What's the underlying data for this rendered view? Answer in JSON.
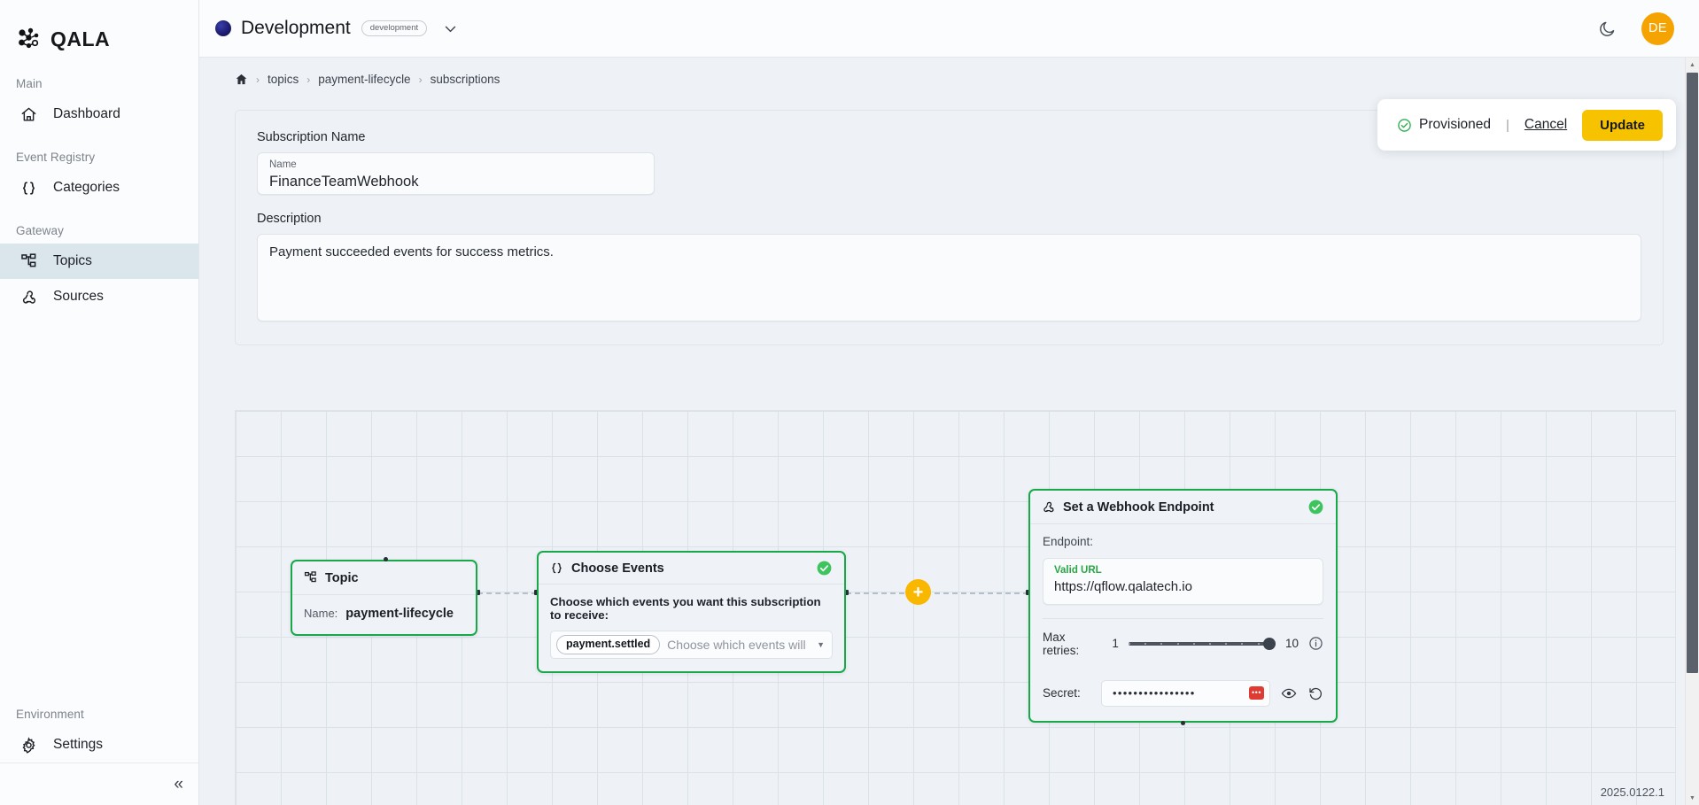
{
  "brand": {
    "name": "QALA"
  },
  "sidebar": {
    "sections": [
      {
        "caption": "Main",
        "items": [
          {
            "label": "Dashboard",
            "icon": "home-icon",
            "active": false
          }
        ]
      },
      {
        "caption": "Event Registry",
        "items": [
          {
            "label": "Categories",
            "icon": "braces-icon",
            "active": false
          }
        ]
      },
      {
        "caption": "Gateway",
        "items": [
          {
            "label": "Topics",
            "icon": "topics-icon",
            "active": true
          },
          {
            "label": "Sources",
            "icon": "webhook-icon",
            "active": false
          }
        ]
      },
      {
        "caption": "Environment",
        "items": [
          {
            "label": "Settings",
            "icon": "gear-icon",
            "active": false
          }
        ]
      }
    ],
    "collapse_label": "«"
  },
  "topbar": {
    "environment_name": "Development",
    "environment_badge": "development",
    "theme_toggle": "moon-icon",
    "avatar_initials": "DE"
  },
  "breadcrumb": {
    "home": "home-icon",
    "items": [
      "topics",
      "payment-lifecycle",
      "subscriptions"
    ],
    "separator": "›"
  },
  "action_bar": {
    "status": "Provisioned",
    "divider": "|",
    "cancel_label": "Cancel",
    "update_label": "Update"
  },
  "form": {
    "subscription_name_label": "Subscription Name",
    "name_field_label": "Name",
    "name_value": "FinanceTeamWebhook",
    "description_label": "Description",
    "description_value": "Payment succeeded events for success metrics."
  },
  "canvas": {
    "version": "2025.0122.1",
    "add_node_label": "+",
    "nodes": {
      "topic": {
        "title": "Topic",
        "icon": "topics-icon",
        "name_key": "Name:",
        "name_value": "payment-lifecycle"
      },
      "events": {
        "title": "Choose Events",
        "icon": "braces-icon",
        "status": "check-icon",
        "hint": "Choose which events you want this subscription to receive:",
        "chips": [
          "payment.settled"
        ],
        "placeholder": "Choose which events will be publis..."
      },
      "webhook": {
        "title": "Set a Webhook Endpoint",
        "icon": "webhook-icon",
        "status": "check-icon",
        "endpoint_label": "Endpoint:",
        "url_state_label": "Valid URL",
        "url_value": "https://qflow.qalatech.io",
        "max_retries_label": "Max retries:",
        "retries_min": "1",
        "retries_max": "10",
        "retries_value": 10,
        "secret_label": "Secret:",
        "secret_masked": "••••••••••••••••"
      }
    }
  },
  "colors": {
    "accent_yellow": "#f7c200",
    "success_green": "#18a84a",
    "avatar_orange": "#f5a300",
    "danger_red": "#e03b32"
  }
}
